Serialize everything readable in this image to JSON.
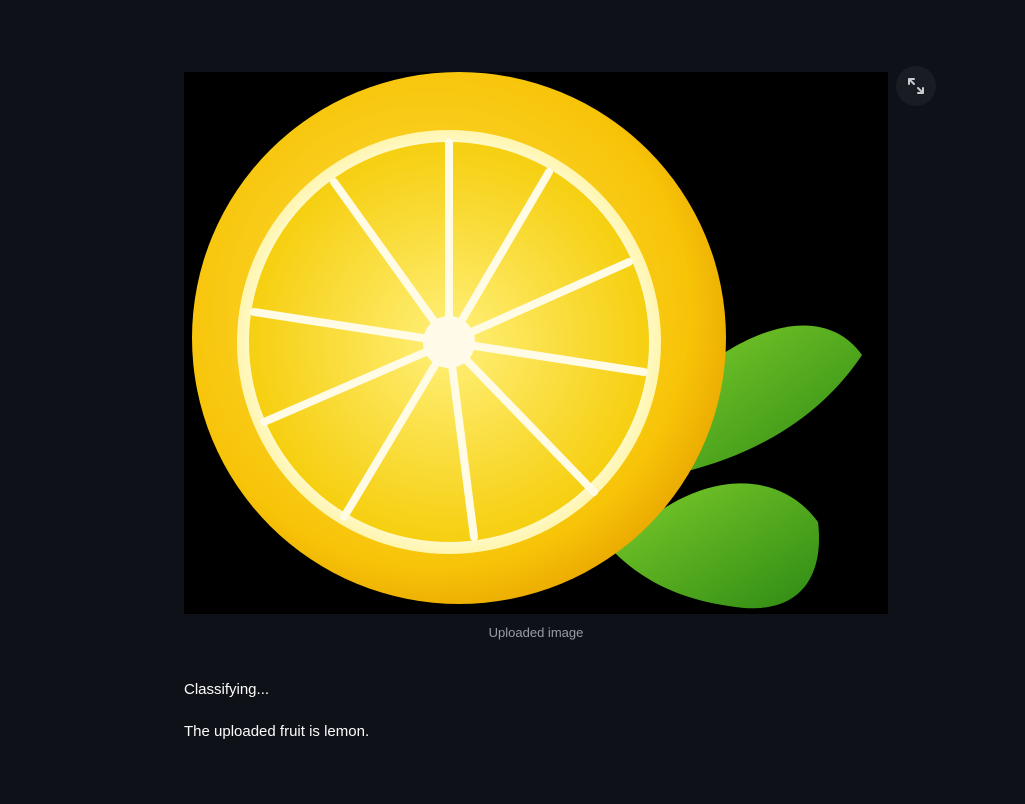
{
  "image": {
    "caption": "Uploaded image",
    "subject_icon": "lemon-slice-image"
  },
  "toolbar": {
    "fullscreen_icon": "expand-icon"
  },
  "output": {
    "status": "Classifying...",
    "result": "The uploaded fruit is lemon."
  },
  "colors": {
    "background": "#0e1117",
    "text": "#fafafa",
    "caption": "#9a9ca4",
    "lemon": "#f9d20e",
    "leaf": "#4ca41c"
  }
}
